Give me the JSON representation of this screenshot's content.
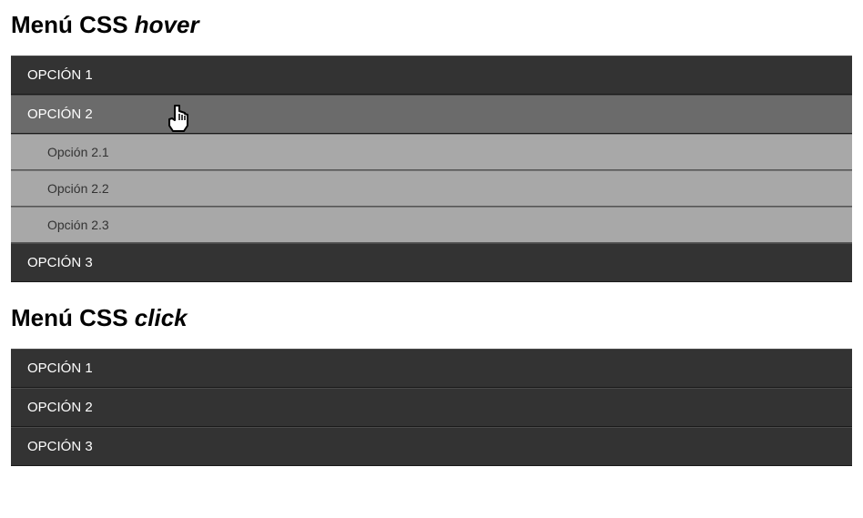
{
  "hoverMenu": {
    "heading_prefix": "Menú CSS ",
    "heading_italic": "hover",
    "items": [
      {
        "label": "OPCIÓN 1",
        "children": []
      },
      {
        "label": "OPCIÓN 2",
        "hovered": true,
        "children": [
          {
            "label": "Opción 2.1"
          },
          {
            "label": "Opción 2.2"
          },
          {
            "label": "Opción 2.3"
          }
        ]
      },
      {
        "label": "OPCIÓN 3",
        "children": []
      }
    ]
  },
  "clickMenu": {
    "heading_prefix": "Menú CSS ",
    "heading_italic": "click",
    "items": [
      {
        "label": "OPCIÓN 1"
      },
      {
        "label": "OPCIÓN 2"
      },
      {
        "label": "OPCIÓN 3"
      }
    ]
  }
}
